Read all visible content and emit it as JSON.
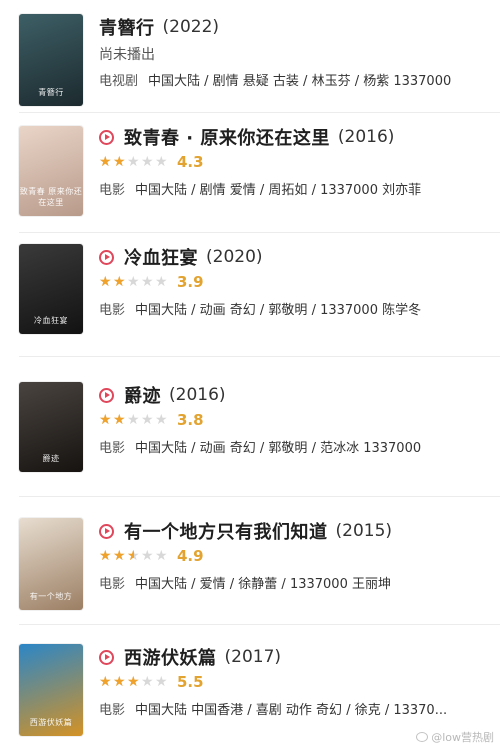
{
  "items": [
    {
      "title": "青簪行",
      "year": "(2022)",
      "has_play": false,
      "status": "尚未播出",
      "rating": null,
      "category": "电视剧",
      "meta": "中国大陆 / 剧情 悬疑 古装 / 林玉芬 / 杨紫 1337000",
      "poster_text": "青簪行",
      "colors": [
        "#3d5f66",
        "#1c2a2e"
      ]
    },
    {
      "title": "致青春 · 原来你还在这里",
      "year": "(2016)",
      "has_play": true,
      "status": "",
      "rating": {
        "score": "4.3",
        "stars": 2
      },
      "category": "电影",
      "meta": "中国大陆 / 剧情 爱情 / 周拓如 / 1337000 刘亦菲",
      "poster_text": "致青春 原来你还在这里",
      "colors": [
        "#e9d5c8",
        "#b89a8a"
      ]
    },
    {
      "title": "冷血狂宴",
      "year": "(2020)",
      "has_play": true,
      "status": "",
      "rating": {
        "score": "3.9",
        "stars": 2
      },
      "category": "电影",
      "meta": "中国大陆 / 动画 奇幻 / 郭敬明 / 1337000 陈学冬",
      "poster_text": "冷血狂宴",
      "colors": [
        "#3a3a3a",
        "#121212"
      ]
    },
    {
      "title": "爵迹",
      "year": "(2016)",
      "has_play": true,
      "status": "",
      "rating": {
        "score": "3.8",
        "stars": 2
      },
      "category": "电影",
      "meta": "中国大陆 / 动画 奇幻 / 郭敬明 / 范冰冰 1337000",
      "poster_text": "爵迹",
      "colors": [
        "#4a4440",
        "#161310"
      ]
    },
    {
      "title": "有一个地方只有我们知道",
      "year": "(2015)",
      "has_play": true,
      "status": "",
      "rating": {
        "score": "4.9",
        "stars": 2.5
      },
      "category": "电影",
      "meta": "中国大陆 / 爱情 / 徐静蕾 / 1337000 王丽坤",
      "poster_text": "有一个地方",
      "colors": [
        "#e7ddd0",
        "#9c7f64"
      ]
    },
    {
      "title": "西游伏妖篇",
      "year": "(2017)",
      "has_play": true,
      "status": "",
      "rating": {
        "score": "5.5",
        "stars": 3
      },
      "category": "电影",
      "meta": "中国大陆 中国香港 / 喜剧 动作 奇幻 / 徐克 / 13370...",
      "poster_text": "西游伏妖篇",
      "colors": [
        "#2b86c7",
        "#d49225"
      ]
    }
  ],
  "watermark": "@low营热剧"
}
